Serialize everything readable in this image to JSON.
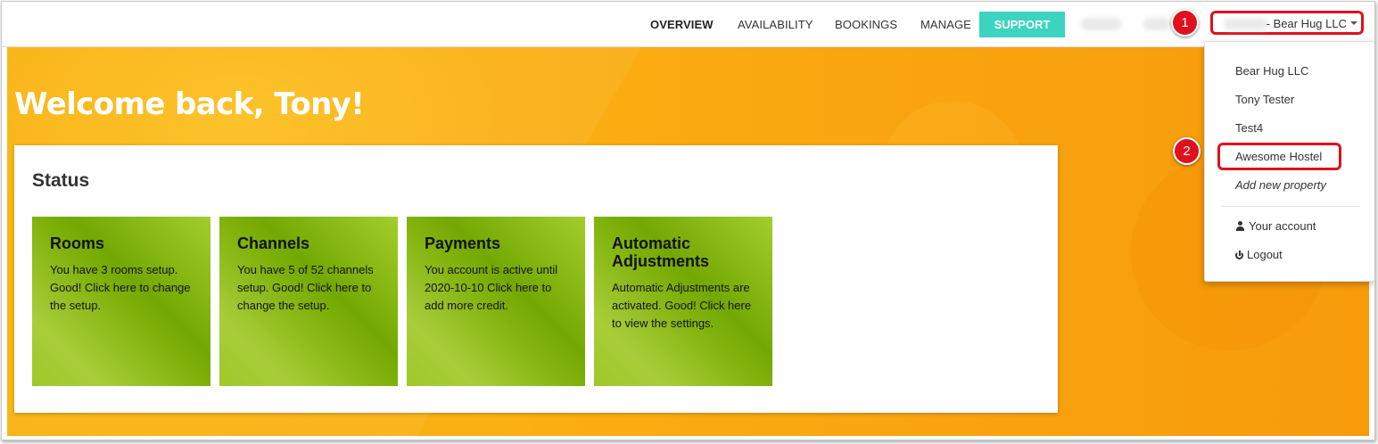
{
  "nav": {
    "links": [
      "OVERVIEW",
      "AVAILABILITY",
      "BOOKINGS",
      "MANAGE"
    ],
    "support": "SUPPORT",
    "account_label": "- Bear Hug LLC"
  },
  "hero": {
    "welcome": "Welcome back, Tony!"
  },
  "status": {
    "title": "Status",
    "tiles": [
      {
        "title": "Rooms",
        "text": "You have 3 rooms setup. Good! Click here to change the setup."
      },
      {
        "title": "Channels",
        "text": "You have 5 of 52 channels setup. Good! Click here to change the setup."
      },
      {
        "title": "Payments",
        "text": "You account is active until 2020-10-10 Click here to add more credit."
      },
      {
        "title": "Automatic Adjustments",
        "text": "Automatic Adjustments are activated. Good! Click here to view the settings."
      }
    ]
  },
  "menu": {
    "properties": [
      "Bear Hug LLC",
      "Tony Tester",
      "Test4",
      "Awesome Hostel"
    ],
    "add_new": "Add new property",
    "your_account": "Your account",
    "logout": "Logout"
  },
  "annotations": {
    "badge1": "1",
    "badge2": "2"
  },
  "colors": {
    "accent": "#3dd4bf",
    "hero": "#f9a30f",
    "tile": "#8dbd17",
    "highlight": "#e0101e"
  }
}
